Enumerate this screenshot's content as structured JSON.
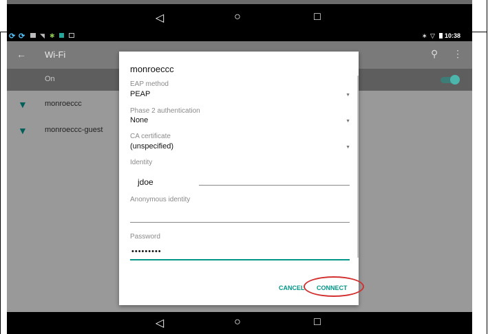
{
  "nav_icons": [
    "back-triangle",
    "home-circle",
    "recents-square"
  ],
  "nav_glyphs": {
    "back": "◁",
    "home": "○",
    "recents": "□"
  },
  "status": {
    "time": "10:38",
    "icons": [
      "S",
      "S"
    ]
  },
  "appbar": {
    "title": "Wi-Fi",
    "back_glyph": "←",
    "search_glyph": "⚲",
    "more_glyph": "⋮"
  },
  "wifi_toggle": {
    "label": "On",
    "state": "on"
  },
  "networks": [
    {
      "name": "monroeccc"
    },
    {
      "name": "monroeccc-guest"
    }
  ],
  "dialog": {
    "title": "monroeccc",
    "eap_label": "EAP method",
    "eap_value": "PEAP",
    "phase2_label": "Phase 2 authentication",
    "phase2_value": "None",
    "ca_label": "CA certificate",
    "ca_value": "(unspecified)",
    "identity_label": "Identity",
    "identity_value": "jdoe",
    "anon_label": "Anonymous identity",
    "anon_value": "",
    "password_label": "Password",
    "password_value": "•••••••••",
    "cancel_label": "CANCEL",
    "connect_label": "CONNECT"
  },
  "colors": {
    "accent": "#009688",
    "highlight": "#d32f2f"
  }
}
